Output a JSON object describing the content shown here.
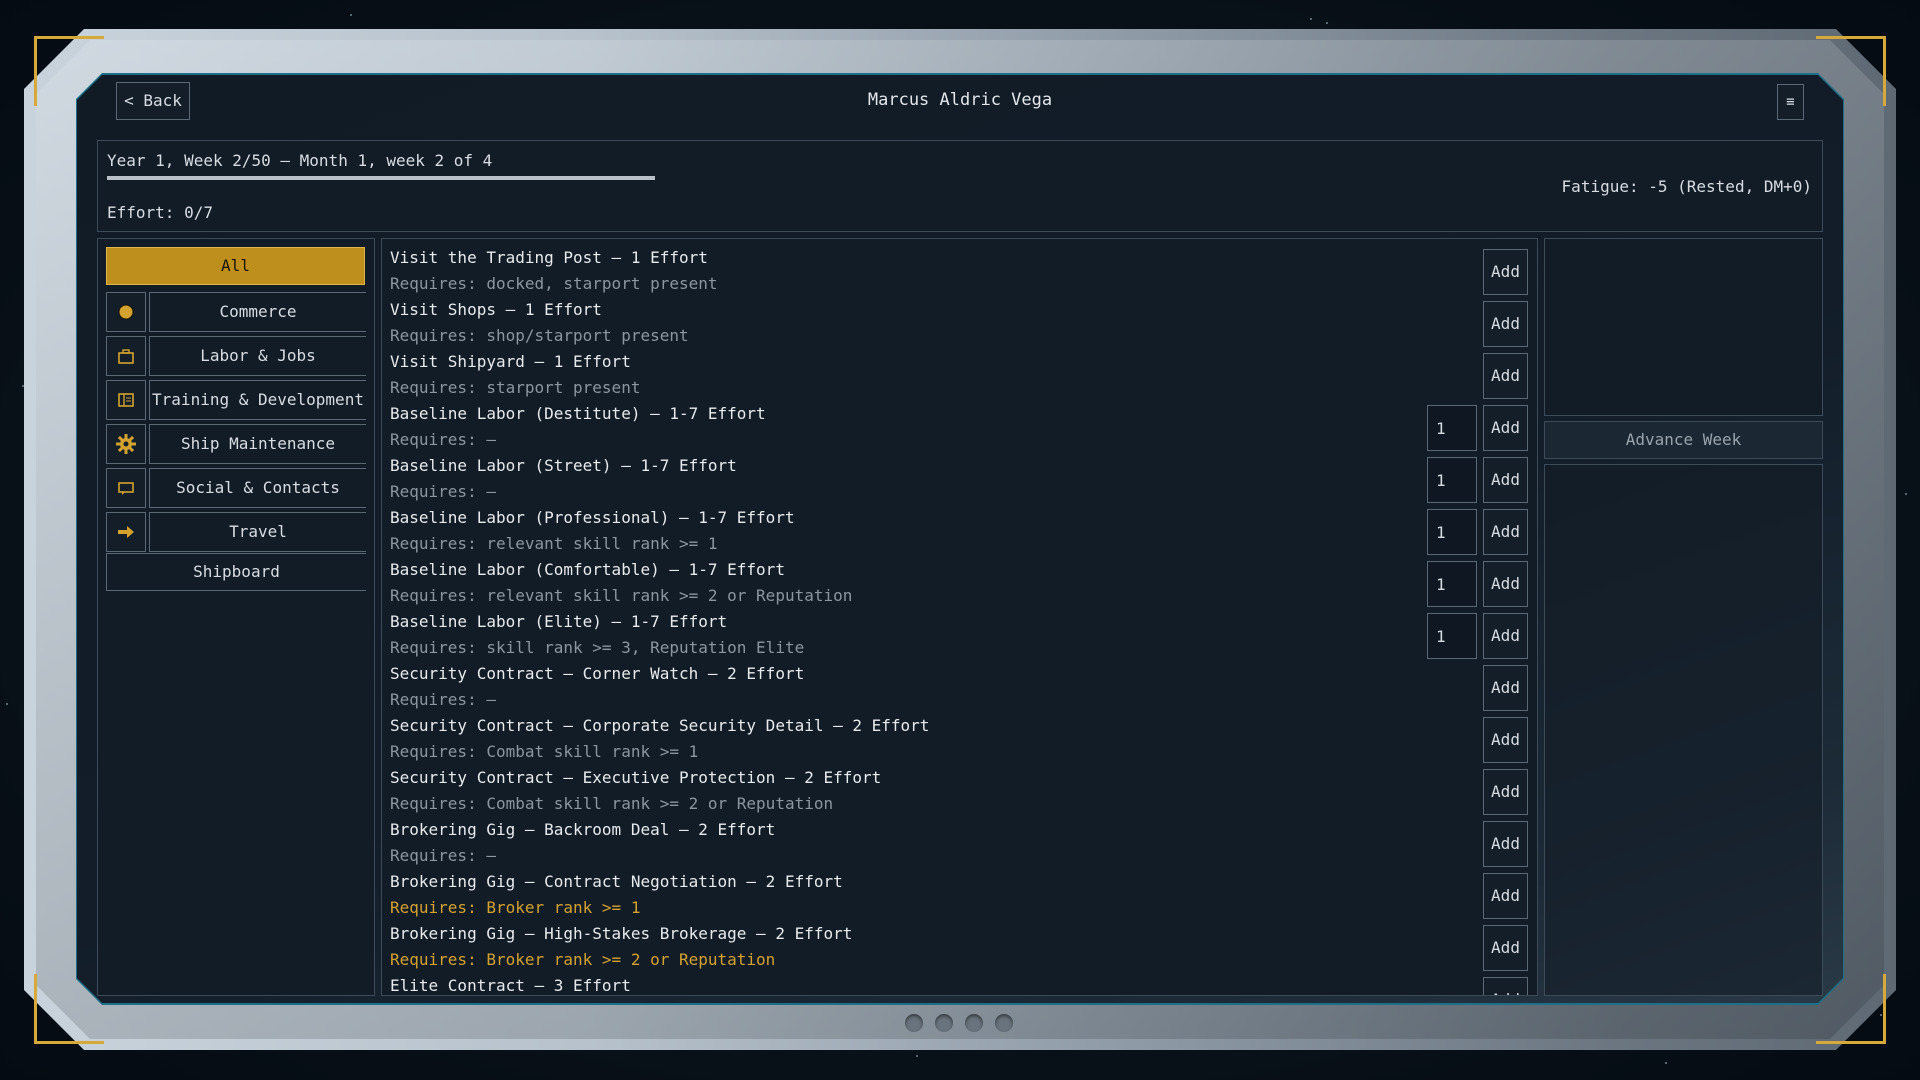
{
  "header": {
    "back_label": "< Back",
    "title": "Marcus Aldric Vega",
    "menu_label": "≡"
  },
  "status": {
    "date_line": "Year 1, Week 2/50 — Month 1, week 2 of 4",
    "week_progress_fraction": 0.04,
    "effort_line": "Effort: 0/7",
    "fatigue_line": "Fatigue: -5 (Rested, DM+0)"
  },
  "categories": {
    "all_label": "All",
    "items": [
      {
        "label": "Commerce",
        "icon": "circle-icon"
      },
      {
        "label": "Labor & Jobs",
        "icon": "briefcase-icon"
      },
      {
        "label": "Training & Development",
        "icon": "book-icon"
      },
      {
        "label": "Ship Maintenance",
        "icon": "gear-icon"
      },
      {
        "label": "Social & Contacts",
        "icon": "chat-icon"
      },
      {
        "label": "Travel",
        "icon": "arrow-right-icon"
      }
    ],
    "shipboard_label": "Shipboard"
  },
  "activities": [
    {
      "name": "Visit the Trading Post — 1 Effort",
      "req": "Requires: docked, starport present",
      "qty": null,
      "warn": false
    },
    {
      "name": "Visit Shops — 1 Effort",
      "req": "Requires: shop/starport present",
      "qty": null,
      "warn": false
    },
    {
      "name": "Visit Shipyard — 1 Effort",
      "req": "Requires: starport present",
      "qty": null,
      "warn": false
    },
    {
      "name": "Baseline Labor (Destitute) — 1-7 Effort",
      "req": "Requires: —",
      "qty": "1",
      "warn": false
    },
    {
      "name": "Baseline Labor (Street) — 1-7 Effort",
      "req": "Requires: —",
      "qty": "1",
      "warn": false
    },
    {
      "name": "Baseline Labor (Professional) — 1-7 Effort",
      "req": "Requires: relevant skill rank >= 1",
      "qty": "1",
      "warn": false
    },
    {
      "name": "Baseline Labor (Comfortable) — 1-7 Effort",
      "req": "Requires: relevant skill rank >= 2 or Reputation",
      "qty": "1",
      "warn": false
    },
    {
      "name": "Baseline Labor (Elite) — 1-7 Effort",
      "req": "Requires: skill rank >= 3, Reputation Elite",
      "qty": "1",
      "warn": false
    },
    {
      "name": "Security Contract — Corner Watch — 2 Effort",
      "req": "Requires: —",
      "qty": null,
      "warn": false
    },
    {
      "name": "Security Contract — Corporate Security Detail — 2 Effort",
      "req": "Requires: Combat skill rank >= 1",
      "qty": null,
      "warn": false
    },
    {
      "name": "Security Contract — Executive Protection — 2 Effort",
      "req": "Requires: Combat skill rank >= 2 or Reputation",
      "qty": null,
      "warn": false
    },
    {
      "name": "Brokering Gig — Backroom Deal — 2 Effort",
      "req": "Requires: —",
      "qty": null,
      "warn": false
    },
    {
      "name": "Brokering Gig — Contract Negotiation — 2 Effort",
      "req": "Requires: Broker rank >= 1",
      "qty": null,
      "warn": true
    },
    {
      "name": "Brokering Gig — High-Stakes Brokerage — 2 Effort",
      "req": "Requires: Broker rank >= 2 or Reputation",
      "qty": null,
      "warn": true
    },
    {
      "name": "Elite Contract — 3 Effort",
      "req": "",
      "qty": null,
      "warn": false
    }
  ],
  "add_label": "Add",
  "advance_week_label": "Advance Week",
  "colors": {
    "accent": "#bf8f1d",
    "warning_text": "#d4a22e",
    "panel_bg": "#121c27",
    "frame_teal": "#1b6f88"
  }
}
